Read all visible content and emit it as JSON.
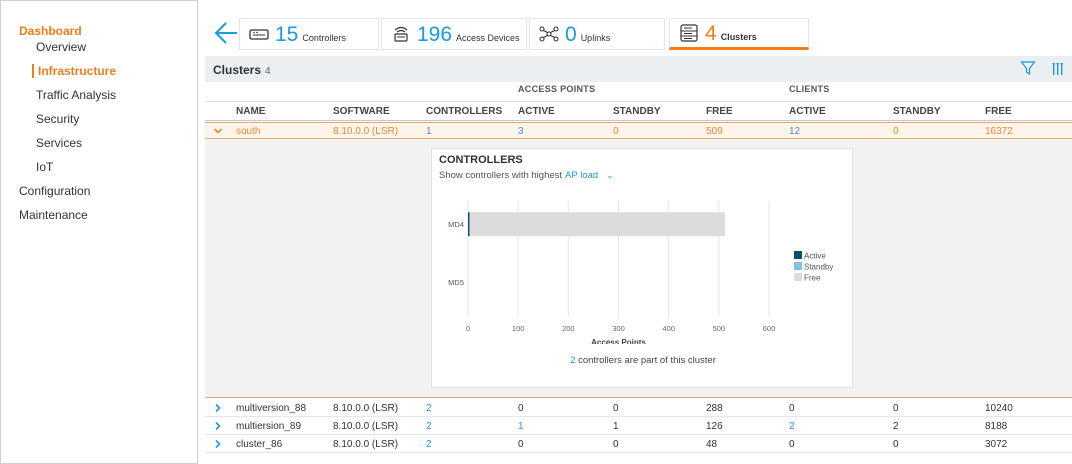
{
  "sidebar": {
    "sections": [
      {
        "label": "Dashboard",
        "active": true
      },
      {
        "label": "Configuration",
        "active": false
      },
      {
        "label": "Maintenance",
        "active": false
      }
    ],
    "dashboard_items": [
      {
        "label": "Overview"
      },
      {
        "label": "Infrastructure"
      },
      {
        "label": "Traffic Analysis"
      },
      {
        "label": "Security"
      },
      {
        "label": "Services"
      },
      {
        "label": "IoT"
      }
    ]
  },
  "tiles": [
    {
      "icon": "controller-icon",
      "count": "15",
      "label": "Controllers"
    },
    {
      "icon": "access-device-icon",
      "count": "196",
      "label": "Access Devices"
    },
    {
      "icon": "uplinks-icon",
      "count": "0",
      "label": "Uplinks"
    },
    {
      "icon": "cluster-icon",
      "count": "4",
      "label": "Clusters"
    }
  ],
  "clusters": {
    "title": "Clusters",
    "count": "4",
    "group_headers": {
      "access_points": "ACCESS POINTS",
      "clients": "CLIENTS"
    },
    "columns": [
      "NAME",
      "SOFTWARE",
      "CONTROLLERS",
      "ACTIVE",
      "STANDBY",
      "FREE",
      "ACTIVE",
      "STANDBY",
      "FREE"
    ],
    "expanded_row": {
      "name": "south",
      "software": "8.10.0.0 (LSR)",
      "controllers": "1",
      "ap_active": "3",
      "ap_standby": "0",
      "ap_free": "509",
      "cl_active": "12",
      "cl_standby": "0",
      "cl_free": "16372"
    },
    "rows": [
      {
        "name": "multiversion_88",
        "software": "8.10.0.0 (LSR)",
        "controllers": "2",
        "ap_active": "0",
        "ap_standby": "0",
        "ap_free": "288",
        "cl_active": "0",
        "cl_standby": "0",
        "cl_free": "10240"
      },
      {
        "name": "multiersion_89",
        "software": "8.10.0.0 (LSR)",
        "controllers": "2",
        "ap_active": "1",
        "ap_standby": "1",
        "ap_free": "126",
        "cl_active": "2",
        "cl_standby": "2",
        "cl_free": "8188"
      },
      {
        "name": "cluster_86",
        "software": "8.10.0.0 (LSR)",
        "controllers": "2",
        "ap_active": "0",
        "ap_standby": "0",
        "ap_free": "48",
        "cl_active": "0",
        "cl_standby": "0",
        "cl_free": "3072"
      }
    ]
  },
  "detail_card": {
    "title": "CONTROLLERS",
    "show_prefix": "Show controllers with highest",
    "show_selection": "AP load",
    "footer_count": "2",
    "footer_text": "controllers are part of this cluster"
  },
  "chart_data": {
    "type": "bar",
    "orientation": "horizontal",
    "stacked": true,
    "categories": [
      "MD4",
      "MD5"
    ],
    "series": [
      {
        "name": "Active",
        "color": "#0d4f6e",
        "values": [
          3,
          0
        ]
      },
      {
        "name": "Standby",
        "color": "#7fc4e6",
        "values": [
          0,
          0
        ]
      },
      {
        "name": "Free",
        "color": "#dcdcdc",
        "values": [
          509,
          0
        ]
      }
    ],
    "xlabel": "Access Points",
    "xlim": [
      0,
      600
    ],
    "xticks": [
      0,
      100,
      200,
      300,
      400,
      500,
      600
    ],
    "grid": true,
    "legend_position": "right"
  },
  "colors": {
    "accent": "#f07c1c",
    "link": "#1a9ae0",
    "header_bg": "#eceff1"
  }
}
